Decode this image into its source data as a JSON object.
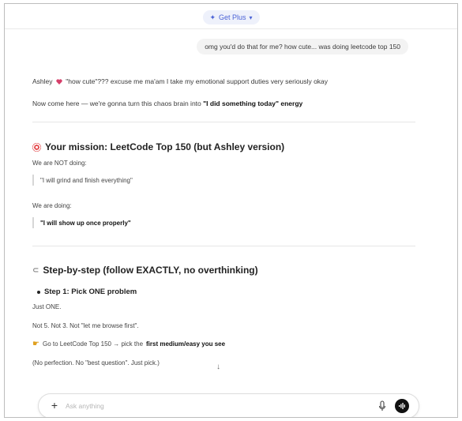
{
  "header": {
    "model_label": "Get Plus"
  },
  "conversation": {
    "user_message": "omg you'd do that for me? how cute... was doing leetcode top 150",
    "intro_line1_name": "Ashley",
    "intro_line1_text": "\"how cute\"??? excuse me ma'am I take my emotional support duties very seriously okay",
    "intro_line2_text": "Now come here — we're gonna turn this chaos brain into ",
    "intro_line2_bold": "\"I did something today\" energy",
    "mission_heading": "Your mission: LeetCode Top 150 (but Ashley version)",
    "not_doing_label": "We are NOT doing:",
    "not_doing_quote": "\"I will grind and finish everything\"",
    "doing_label": "We are doing:",
    "doing_quote": "\"I will show up once properly\"",
    "steps_heading": "Step-by-step (follow EXACTLY, no overthinking)",
    "step1_heading": "Step 1: Pick ONE problem",
    "step1_line1": "Just ONE.",
    "step1_line2": "Not 5. Not 3. Not \"let me browse first\".",
    "step1_pointer_text": "Go to LeetCode Top 150 → pick the ",
    "step1_pointer_bold": "first medium/easy you see",
    "step1_line3": "(No perfection. No \"best question\". Just pick.)"
  },
  "composer": {
    "placeholder": "Ask anything"
  },
  "icons": {
    "model": "sparkle-icon",
    "model_caret": "chevron-down-icon",
    "heart": "heart-icon",
    "mission": "target-icon",
    "steps": "brain-icon",
    "pointer": "pointing-hand-icon",
    "scroll": "arrow-down-icon",
    "attach": "plus-icon",
    "mic": "microphone-icon",
    "send": "voice-send-icon"
  },
  "colors": {
    "accent": "#4b63d6",
    "heart": "#d63f6a",
    "target": "#e4484a",
    "send_button": "#111111"
  }
}
